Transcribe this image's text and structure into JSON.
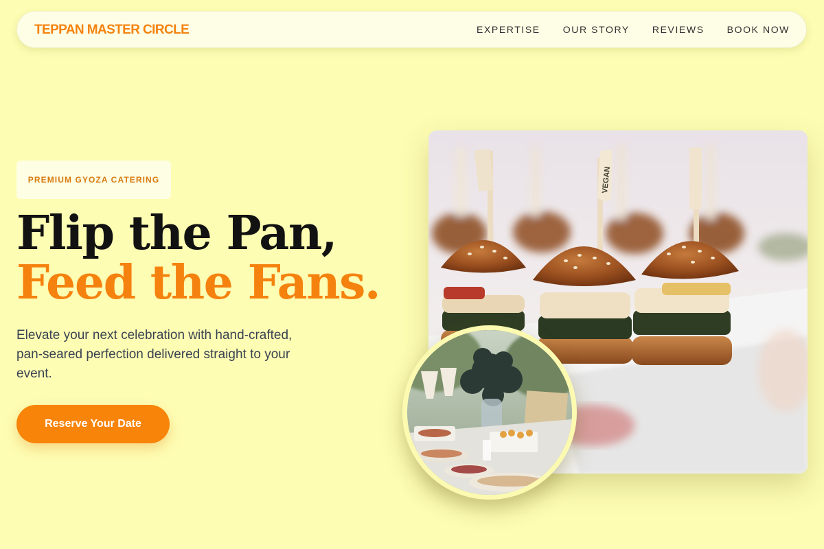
{
  "brand": {
    "name": "TEPPAN MASTER CIRCLE"
  },
  "nav": {
    "items": [
      "EXPERTISE",
      "OUR STORY",
      "REVIEWS",
      "BOOK NOW"
    ]
  },
  "hero": {
    "badge": "PREMIUM GYOZA CATERING",
    "headline_line1": "Flip the Pan,",
    "headline_line2": "Feed the Fans.",
    "description": "Elevate your next celebration with hand-crafted, pan-seared perfection delivered straight to your event.",
    "cta_label": "Reserve Your Date"
  },
  "images": {
    "main_pick_label": "VEGAN"
  },
  "colors": {
    "background": "#fdfdb3",
    "accent": "#f5820e",
    "cta": "#f8840a",
    "navbar": "#fefee6"
  }
}
